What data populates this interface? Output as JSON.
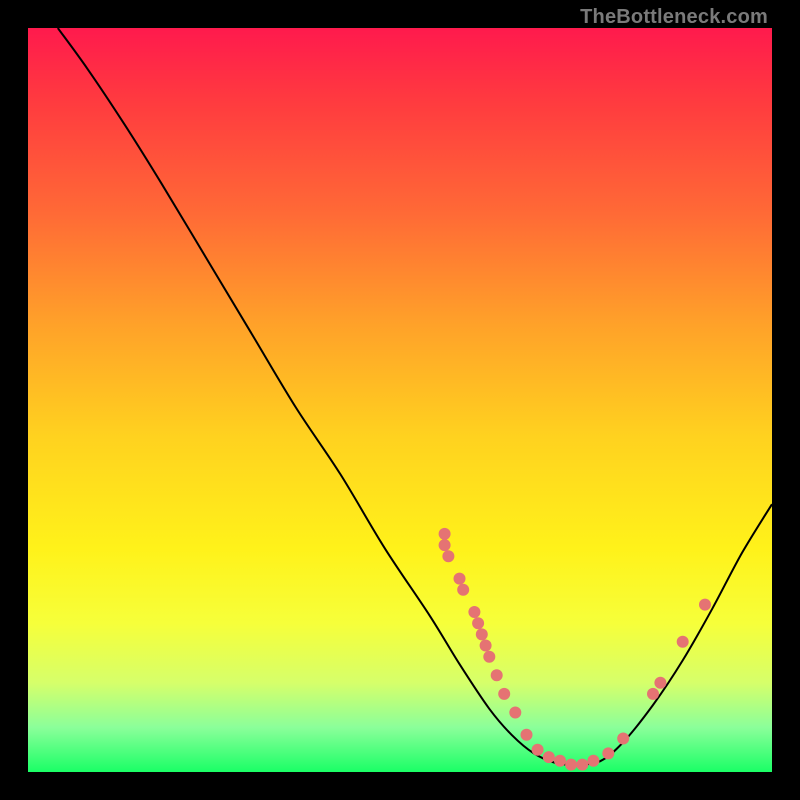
{
  "watermark": "TheBottleneck.com",
  "colors": {
    "page_bg": "#000000",
    "curve": "#000000",
    "point": "#e57373",
    "gradient_top": "#ff1a4d",
    "gradient_bottom": "#1aff66"
  },
  "chart_data": {
    "type": "line",
    "title": "",
    "xlabel": "",
    "ylabel": "",
    "xlim": [
      0,
      100
    ],
    "ylim": [
      0,
      100
    ],
    "annotations": [
      "TheBottleneck.com"
    ],
    "curve_points": [
      {
        "x": 4.0,
        "y": 100.0
      },
      {
        "x": 8.0,
        "y": 94.5
      },
      {
        "x": 13.0,
        "y": 87.0
      },
      {
        "x": 18.0,
        "y": 79.0
      },
      {
        "x": 24.0,
        "y": 69.0
      },
      {
        "x": 30.0,
        "y": 59.0
      },
      {
        "x": 36.0,
        "y": 49.0
      },
      {
        "x": 42.0,
        "y": 40.0
      },
      {
        "x": 48.0,
        "y": 30.0
      },
      {
        "x": 54.0,
        "y": 21.0
      },
      {
        "x": 58.0,
        "y": 14.5
      },
      {
        "x": 62.0,
        "y": 8.5
      },
      {
        "x": 65.0,
        "y": 5.0
      },
      {
        "x": 68.0,
        "y": 2.5
      },
      {
        "x": 71.0,
        "y": 1.2
      },
      {
        "x": 74.0,
        "y": 1.0
      },
      {
        "x": 77.0,
        "y": 1.5
      },
      {
        "x": 80.0,
        "y": 4.0
      },
      {
        "x": 84.0,
        "y": 9.0
      },
      {
        "x": 88.0,
        "y": 15.0
      },
      {
        "x": 92.0,
        "y": 22.0
      },
      {
        "x": 96.0,
        "y": 29.5
      },
      {
        "x": 100.0,
        "y": 36.0
      }
    ],
    "scatter_points": [
      {
        "x": 56.0,
        "y": 32.0
      },
      {
        "x": 56.0,
        "y": 30.5
      },
      {
        "x": 56.5,
        "y": 29.0
      },
      {
        "x": 58.0,
        "y": 26.0
      },
      {
        "x": 58.5,
        "y": 24.5
      },
      {
        "x": 60.0,
        "y": 21.5
      },
      {
        "x": 60.5,
        "y": 20.0
      },
      {
        "x": 61.0,
        "y": 18.5
      },
      {
        "x": 61.5,
        "y": 17.0
      },
      {
        "x": 62.0,
        "y": 15.5
      },
      {
        "x": 63.0,
        "y": 13.0
      },
      {
        "x": 64.0,
        "y": 10.5
      },
      {
        "x": 65.5,
        "y": 8.0
      },
      {
        "x": 67.0,
        "y": 5.0
      },
      {
        "x": 68.5,
        "y": 3.0
      },
      {
        "x": 70.0,
        "y": 2.0
      },
      {
        "x": 71.5,
        "y": 1.5
      },
      {
        "x": 73.0,
        "y": 1.0
      },
      {
        "x": 74.5,
        "y": 1.0
      },
      {
        "x": 76.0,
        "y": 1.5
      },
      {
        "x": 78.0,
        "y": 2.5
      },
      {
        "x": 80.0,
        "y": 4.5
      },
      {
        "x": 84.0,
        "y": 10.5
      },
      {
        "x": 85.0,
        "y": 12.0
      },
      {
        "x": 88.0,
        "y": 17.5
      },
      {
        "x": 91.0,
        "y": 22.5
      }
    ]
  }
}
